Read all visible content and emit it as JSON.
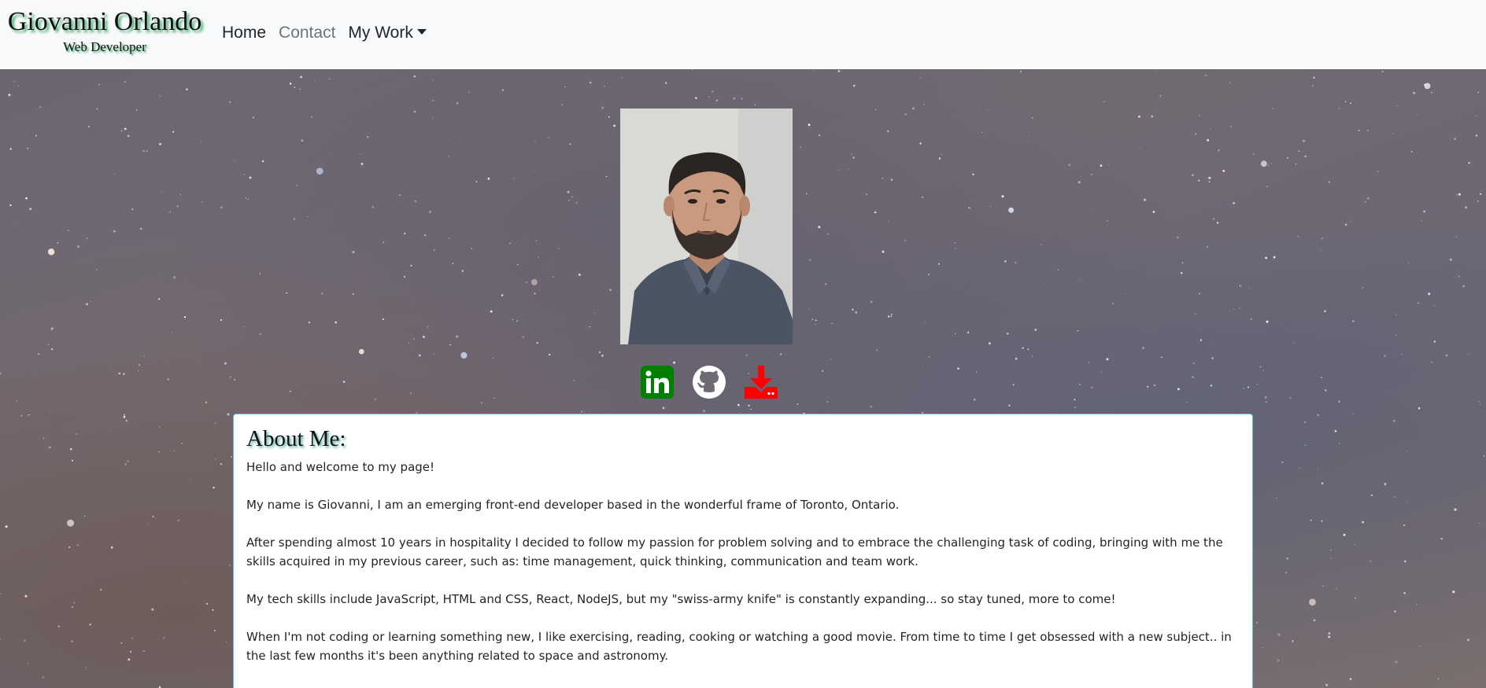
{
  "navbar": {
    "brand_name": "Giovanni Orlando",
    "brand_subtitle": "Web Developer",
    "links": [
      {
        "label": "Home"
      },
      {
        "label": "Contact"
      },
      {
        "label": "My Work"
      }
    ]
  },
  "social": {
    "linkedin_color": "#008000",
    "github_color": "#ffffff",
    "download_color": "#ff0000"
  },
  "about": {
    "title": "About Me:",
    "paragraphs": [
      "Hello and welcome to my page!",
      "My name is Giovanni, I am an emerging front-end developer based in the wonderful frame of Toronto, Ontario.",
      "After spending almost 10 years in hospitality I decided to follow my passion for problem solving and to embrace the challenging task of coding, bringing with me the skills acquired in my previous career, such as: time management, quick thinking, communication and team work.",
      "My tech skills include JavaScript, HTML and CSS, React, NodeJS, but my \"swiss-army knife\" is constantly expanding... so stay tuned, more to come!",
      "When I'm not coding or learning something new, I like exercising, reading, cooking or watching a good movie. From time to time I get obsessed with a new subject.. in the last few months it's been anything related to space and astronomy."
    ]
  }
}
